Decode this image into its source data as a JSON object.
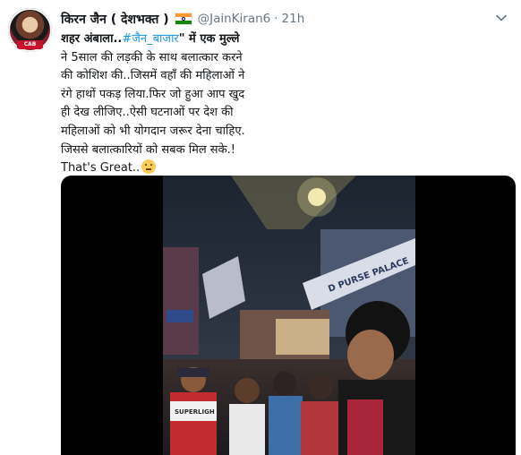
{
  "tweet": {
    "display_name": "किरन जैन ( देशभक्त )",
    "flag_icon": "india-flag-icon",
    "handle": "@JainKiran6",
    "separator": "·",
    "time": "21h",
    "avatar_badge": "CAB",
    "body_lines": [
      {
        "lead": "शहर अंबाला..",
        "link": "#जैन_बाजार",
        "tail": "\" में एक मुल्ले"
      },
      {
        "text": "ने 5साल की लड़की के साथ बलात्कार करने"
      },
      {
        "text": "की कोशिश की..जिसमें वहाँ की महिलाओं ने"
      },
      {
        "text": "रंगे हाथों पकड़ लिया.फिर जो हुआ आप खुद"
      },
      {
        "text": "ही देख लीजिए..ऐसी घटनाओं पर देश की"
      },
      {
        "text": "महिलाओं को भी योगदान जरूर देना चाहिए."
      },
      {
        "text": "जिससे बलात्कारियों को सबक मिल सके.!"
      },
      {
        "text": "That's Great..",
        "emoji": "thinking-face-emoji"
      }
    ],
    "video": {
      "shop_sign": "D PURSE PALACE",
      "jacket_text": "SUPERLIGH"
    }
  }
}
